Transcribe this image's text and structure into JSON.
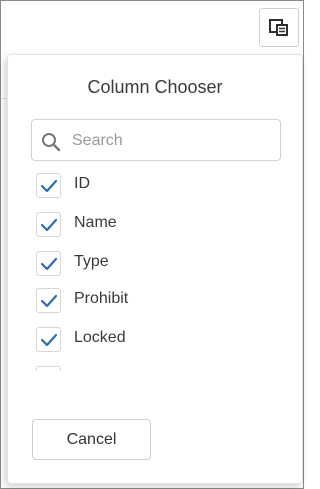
{
  "toolbar": {
    "column_chooser_icon": "column-chooser-icon"
  },
  "popup": {
    "title": "Column Chooser",
    "search": {
      "placeholder": "Search",
      "value": "",
      "icon": "search-icon"
    },
    "columns": [
      {
        "label": "ID",
        "checked": true
      },
      {
        "label": "Name",
        "checked": true
      },
      {
        "label": "Type",
        "checked": true
      },
      {
        "label": "Prohibit",
        "checked": true
      },
      {
        "label": "Locked",
        "checked": true
      }
    ],
    "cancel_label": "Cancel"
  },
  "colors": {
    "checkmark": "#2b6cb0",
    "border": "#cfcfcf",
    "text": "#333333",
    "placeholder": "#9a9a9a"
  }
}
